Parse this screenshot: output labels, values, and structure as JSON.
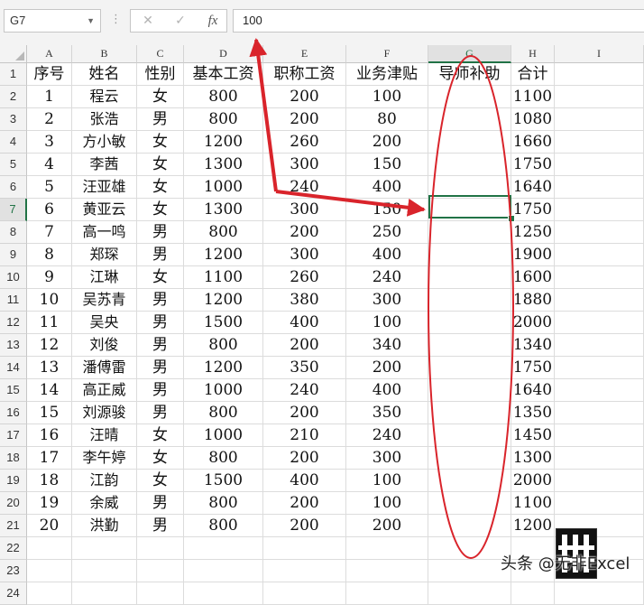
{
  "formula_bar": {
    "name_box": "G7",
    "cancel_icon": "✕",
    "enter_icon": "✓",
    "fx_label": "fx",
    "formula": "100"
  },
  "columns": [
    "A",
    "B",
    "C",
    "D",
    "E",
    "F",
    "G",
    "H",
    "I"
  ],
  "rows": [
    "1",
    "2",
    "3",
    "4",
    "5",
    "6",
    "7",
    "8",
    "9",
    "10",
    "11",
    "12",
    "13",
    "14",
    "15",
    "16",
    "17",
    "18",
    "19",
    "20",
    "21",
    "22",
    "23",
    "24"
  ],
  "sheet": {
    "headers": [
      "序号",
      "姓名",
      "性别",
      "基本工资",
      "职称工资",
      "业务津贴",
      "导师补助",
      "合计"
    ],
    "data": [
      [
        "1",
        "程云",
        "女",
        "800",
        "200",
        "100",
        "",
        "1100"
      ],
      [
        "2",
        "张浩",
        "男",
        "800",
        "200",
        "80",
        "",
        "1080"
      ],
      [
        "3",
        "方小敏",
        "女",
        "1200",
        "260",
        "200",
        "",
        "1660"
      ],
      [
        "4",
        "李茜",
        "女",
        "1300",
        "300",
        "150",
        "",
        "1750"
      ],
      [
        "5",
        "汪亚雄",
        "女",
        "1000",
        "240",
        "400",
        "",
        "1640"
      ],
      [
        "6",
        "黄亚云",
        "女",
        "1300",
        "300",
        "150",
        "",
        "1750"
      ],
      [
        "7",
        "高一鸣",
        "男",
        "800",
        "200",
        "250",
        "",
        "1250"
      ],
      [
        "8",
        "郑琛",
        "男",
        "1200",
        "300",
        "400",
        "",
        "1900"
      ],
      [
        "9",
        "江琳",
        "女",
        "1100",
        "260",
        "240",
        "",
        "1600"
      ],
      [
        "10",
        "吴苏青",
        "男",
        "1200",
        "380",
        "300",
        "",
        "1880"
      ],
      [
        "11",
        "吴央",
        "男",
        "1500",
        "400",
        "100",
        "",
        "2000"
      ],
      [
        "12",
        "刘俊",
        "男",
        "800",
        "200",
        "340",
        "",
        "1340"
      ],
      [
        "13",
        "潘傅雷",
        "男",
        "1200",
        "350",
        "200",
        "",
        "1750"
      ],
      [
        "14",
        "高正威",
        "男",
        "1000",
        "240",
        "400",
        "",
        "1640"
      ],
      [
        "15",
        "刘源骏",
        "男",
        "800",
        "200",
        "350",
        "",
        "1350"
      ],
      [
        "16",
        "汪晴",
        "女",
        "1000",
        "210",
        "240",
        "",
        "1450"
      ],
      [
        "17",
        "李午婷",
        "女",
        "800",
        "200",
        "300",
        "",
        "1300"
      ],
      [
        "18",
        "江韵",
        "女",
        "1500",
        "400",
        "100",
        "",
        "2000"
      ],
      [
        "19",
        "余威",
        "男",
        "800",
        "200",
        "100",
        "",
        "1100"
      ],
      [
        "20",
        "洪勤",
        "男",
        "800",
        "200",
        "200",
        "",
        "1200"
      ]
    ]
  },
  "selected_cell": "G7",
  "annotation_color": "#d9242b",
  "selection_color": "#217346",
  "watermark": "头条 @无非Excel"
}
